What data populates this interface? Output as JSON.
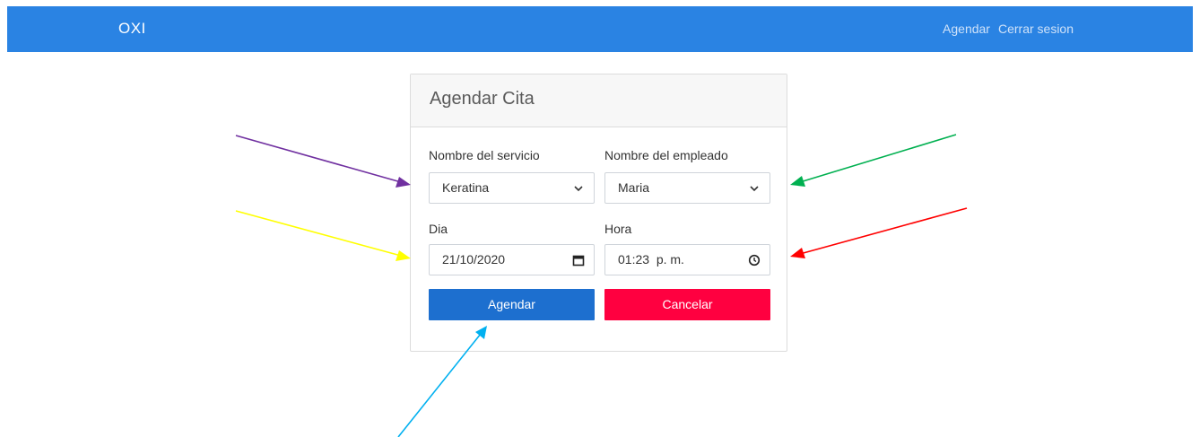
{
  "navbar": {
    "brand": "OXI",
    "links": [
      "Agendar",
      "Cerrar sesion"
    ]
  },
  "card": {
    "title": "Agendar Cita",
    "servicio": {
      "label": "Nombre del servicio",
      "value": "Keratina"
    },
    "empleado": {
      "label": "Nombre del empleado",
      "value": "Maria"
    },
    "dia": {
      "label": "Dia",
      "value": "21/10/2020"
    },
    "hora": {
      "label": "Hora",
      "value": "01:23  p. m."
    },
    "submit_label": "Agendar",
    "cancel_label": "Cancelar"
  },
  "annotation_arrow_colors": {
    "servicio": "#7030a0",
    "empleado": "#00b050",
    "dia": "#ffff00",
    "hora": "#ff0000",
    "agendar": "#00b0f0"
  }
}
